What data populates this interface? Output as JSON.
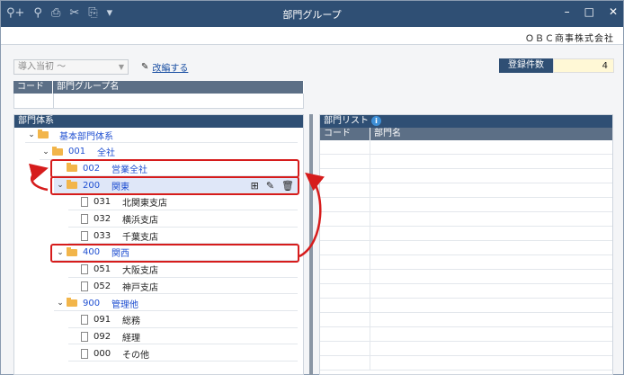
{
  "window": {
    "title": "部門グループ",
    "company": "ＯＢＣ商事株式会社"
  },
  "toolbar": {
    "tools": [
      "search-add-icon",
      "search-icon",
      "print-icon",
      "tools-icon",
      "export-icon",
      "dropdown-icon"
    ]
  },
  "filter": {
    "select_value": "導入当初 ～",
    "edit_label": "改編する"
  },
  "registered": {
    "label": "登録件数",
    "value": "4"
  },
  "group_grid": {
    "col_code": "コード",
    "col_name": "部門グループ名"
  },
  "left_panel": {
    "title": "部門体系",
    "tree": [
      {
        "level": 0,
        "type": "folder",
        "code": "",
        "name": "基本部門体系",
        "expanded": true,
        "blue": true
      },
      {
        "level": 1,
        "type": "folder",
        "code": "001",
        "name": "全社",
        "expanded": true,
        "blue": true
      },
      {
        "level": 2,
        "type": "folder",
        "code": "002",
        "name": "営業全社",
        "expanded": false,
        "blue": true,
        "highlight": true
      },
      {
        "level": 2,
        "type": "folder",
        "code": "200",
        "name": "関東",
        "expanded": true,
        "blue": true,
        "highlight": true,
        "selected": true
      },
      {
        "level": 3,
        "type": "doc",
        "code": "031",
        "name": "北関東支店"
      },
      {
        "level": 3,
        "type": "doc",
        "code": "032",
        "name": "横浜支店"
      },
      {
        "level": 3,
        "type": "doc",
        "code": "033",
        "name": "千葉支店"
      },
      {
        "level": 2,
        "type": "folder",
        "code": "400",
        "name": "関西",
        "expanded": true,
        "blue": true,
        "highlight": true
      },
      {
        "level": 3,
        "type": "doc",
        "code": "051",
        "name": "大阪支店"
      },
      {
        "level": 3,
        "type": "doc",
        "code": "052",
        "name": "神戸支店"
      },
      {
        "level": 2,
        "type": "folder",
        "code": "900",
        "name": "管理他",
        "expanded": true,
        "blue": true
      },
      {
        "level": 3,
        "type": "doc",
        "code": "091",
        "name": "総務"
      },
      {
        "level": 3,
        "type": "doc",
        "code": "092",
        "name": "経理"
      },
      {
        "level": 3,
        "type": "doc",
        "code": "000",
        "name": "その他"
      }
    ]
  },
  "right_panel": {
    "title": "部門リスト",
    "col_code": "コード",
    "col_name": "部門名"
  },
  "colors": {
    "header": "#2f4f74",
    "highlight": "#d61c1c",
    "folder": "#f2b54a",
    "link_blue": "#1f4fd1"
  }
}
